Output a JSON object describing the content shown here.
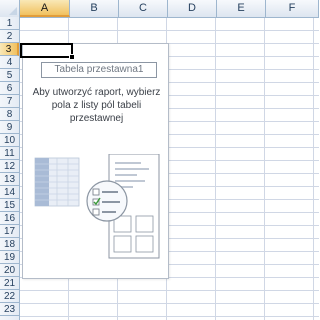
{
  "columns": [
    "A",
    "B",
    "C",
    "D",
    "E",
    "F"
  ],
  "active_column": "A",
  "rows": [
    "1",
    "2",
    "3",
    "4",
    "5",
    "6",
    "7",
    "8",
    "9",
    "10",
    "11",
    "12",
    "13",
    "14",
    "15",
    "16",
    "17",
    "18",
    "19",
    "20",
    "21",
    "22",
    "23"
  ],
  "active_row": "3",
  "pivot": {
    "title": "Tabela przestawna1",
    "instructions": "Aby utworzyć raport, wybierz pola z listy pól tabeli przestawnej",
    "illustration_icon": "pivot-field-list-illustration"
  },
  "colors": {
    "header_bg": "#dde5f0",
    "active_header": "#f1c15f",
    "gridline": "#d0d7e5"
  }
}
